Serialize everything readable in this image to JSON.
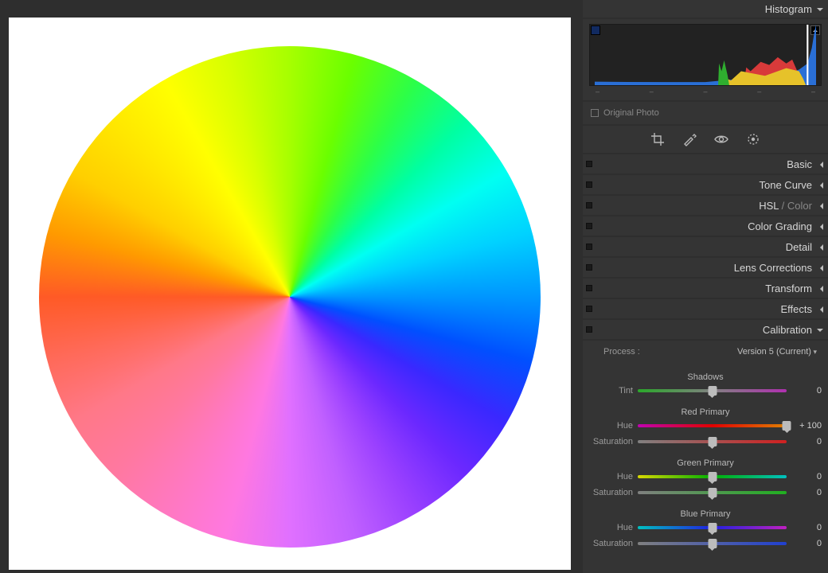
{
  "histogram": {
    "title": "Histogram",
    "ticks": [
      "–",
      "–",
      "–",
      "–",
      "–"
    ]
  },
  "original": {
    "label": "Original Photo",
    "checked": false
  },
  "tools": [
    "crop-icon",
    "brush-icon",
    "eye-icon",
    "radial-icon"
  ],
  "panels": {
    "basic": "Basic",
    "tone_curve": "Tone Curve",
    "hsl_prefix": "HSL ",
    "hsl_sep": "/ ",
    "hsl_color": "Color",
    "color_grading": "Color Grading",
    "detail": "Detail",
    "lens": "Lens Corrections",
    "transform": "Transform",
    "effects": "Effects",
    "calibration": "Calibration"
  },
  "calibration": {
    "process_label": "Process :",
    "process_value": "Version 5 (Current)",
    "shadows_title": "Shadows",
    "tint": {
      "label": "Tint",
      "value": "0",
      "pos": 50
    },
    "red_title": "Red Primary",
    "red_hue": {
      "label": "Hue",
      "value": "+ 100",
      "pos": 100
    },
    "red_sat": {
      "label": "Saturation",
      "value": "0",
      "pos": 50
    },
    "green_title": "Green Primary",
    "green_hue": {
      "label": "Hue",
      "value": "0",
      "pos": 50
    },
    "green_sat": {
      "label": "Saturation",
      "value": "0",
      "pos": 50
    },
    "blue_title": "Blue Primary",
    "blue_hue": {
      "label": "Hue",
      "value": "0",
      "pos": 50
    },
    "blue_sat": {
      "label": "Saturation",
      "value": "0",
      "pos": 50
    }
  }
}
